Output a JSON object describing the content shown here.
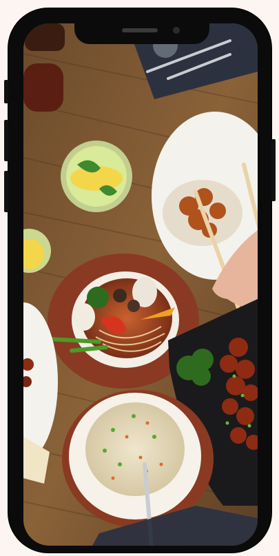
{
  "device": {
    "model": "smartphone",
    "screen_content": "food-photo"
  },
  "colors": {
    "page_background": "#fdf5f1",
    "frame": "#0b0b0c",
    "table_wood": "#7a5733",
    "napkin": "#2c3140",
    "bowl_rim": "#8a3a22",
    "soup_broth": "#b5522b",
    "rice": "#e7dcc0",
    "chicken": "#8e2b12",
    "broccoli": "#2f6b1e",
    "lemon": "#f4d64a",
    "plate_white": "#f4f2ec"
  }
}
